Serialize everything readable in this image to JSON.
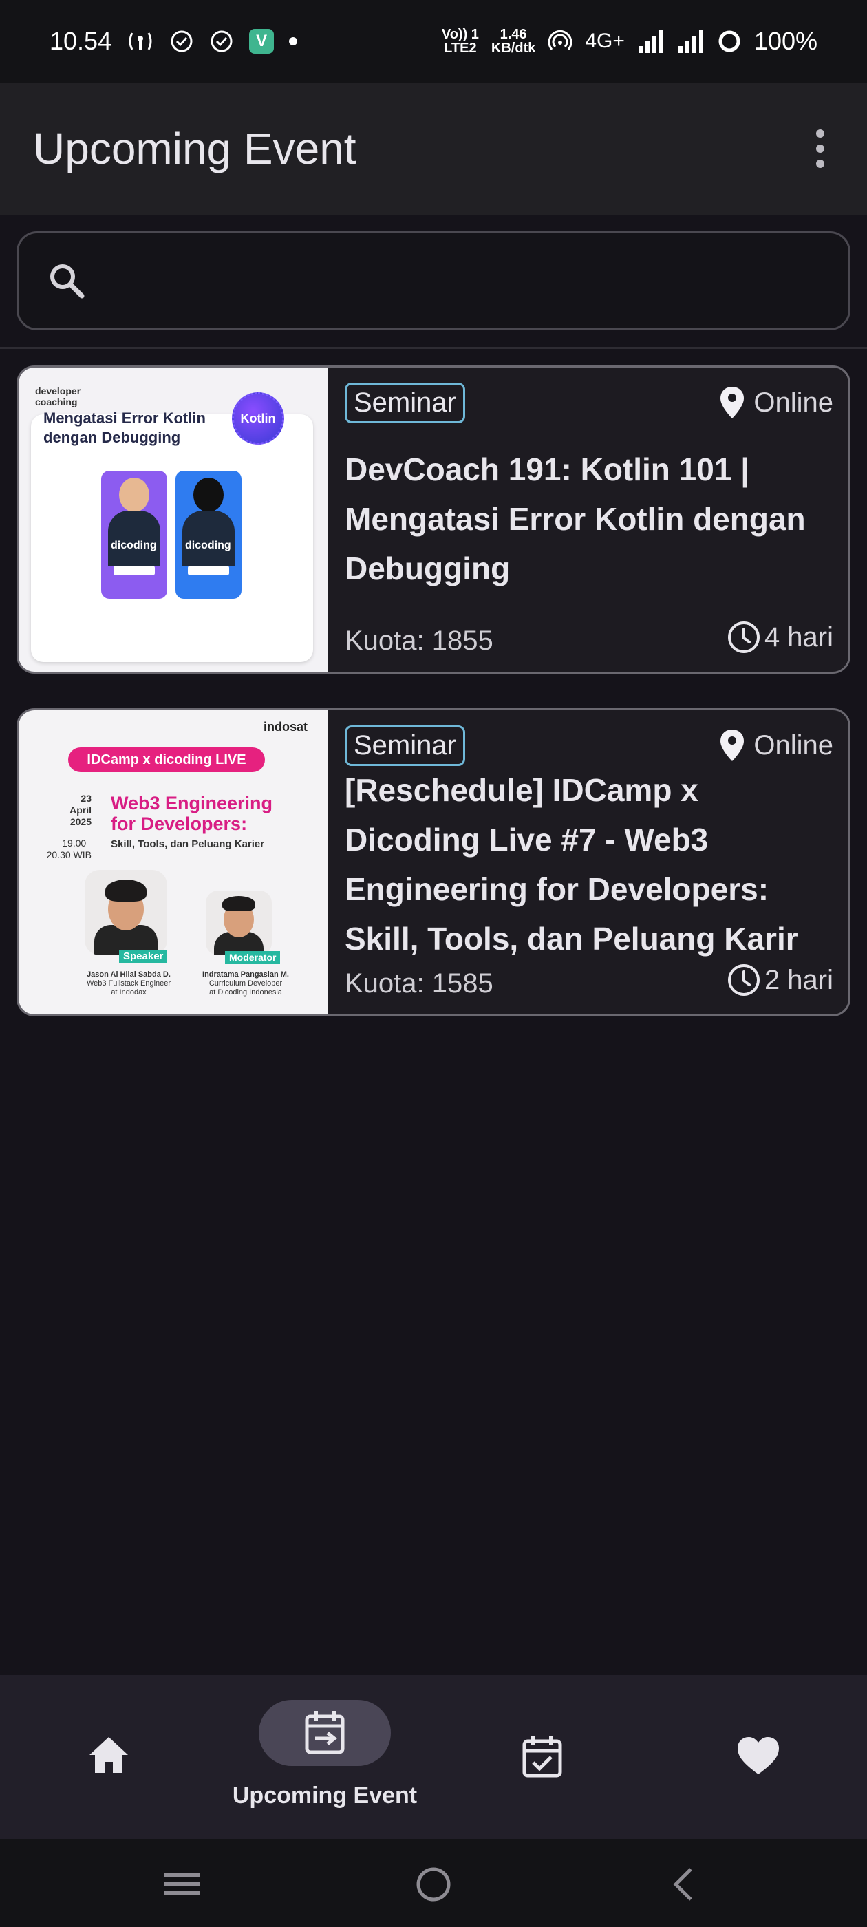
{
  "status_bar": {
    "time": "10.54",
    "volte_top": "Vo)) 1",
    "volte_bottom": "LTE2",
    "speed_top": "1.46",
    "speed_bottom": "KB/dtk",
    "network": "4G+",
    "battery": "100%",
    "app_badge": "V"
  },
  "app_bar": {
    "title": "Upcoming Event"
  },
  "search": {
    "placeholder": ""
  },
  "events": [
    {
      "category": "Seminar",
      "location": "Online",
      "title": "DevCoach 191: Kotlin 101 | Mengatasi Error Kotlin dengan Debugging",
      "quota_label": "Kuota:",
      "quota_value": "1855",
      "time_left": "4 hari",
      "thumb": {
        "brand_line1": "developer",
        "brand_line2": "coaching",
        "headline": "Mengatasi Error Kotlin dengan Debugging",
        "badge": "Kotlin",
        "person1_brand": "dicoding",
        "person2_brand": "dicoding"
      }
    },
    {
      "category": "Seminar",
      "location": "Online",
      "title": "[Reschedule] IDCamp x Dicoding Live #7 - Web3 Engineering for Developers: Skill, Tools, dan Peluang Karir",
      "quota_label": "Kuota:",
      "quota_value": "1585",
      "time_left": "2 hari",
      "thumb": {
        "corner_brand": "indosat",
        "pill": "IDCamp x dicoding LIVE",
        "date_line1": "23",
        "date_line2": "April",
        "date_line3": "2025",
        "time_line1": "19.00–",
        "time_line2": "20.30 WIB",
        "headline_line1": "Web3 Engineering",
        "headline_line2": "for Developers:",
        "subline": "Skill, Tools, dan Peluang Karier",
        "speaker_label": "Speaker",
        "moderator_label": "Moderator",
        "speaker_name": "Jason Al Hilal Sabda D.",
        "speaker_role_1": "Web3 Fullstack Engineer",
        "speaker_role_2": "at Indodax",
        "moderator_name": "Indratama Pangasian M.",
        "moderator_role_1": "Curriculum Developer",
        "moderator_role_2": "at Dicoding Indonesia"
      }
    }
  ],
  "bottom_nav": {
    "active_label": "Upcoming Event",
    "items": [
      "home-icon",
      "upcoming-event-icon",
      "finished-event-icon",
      "favorite-icon"
    ]
  },
  "colors": {
    "background": "#15131a",
    "app_bar": "#212024",
    "chip_border": "#6fb8d8",
    "nav_pill": "#4a4656"
  }
}
